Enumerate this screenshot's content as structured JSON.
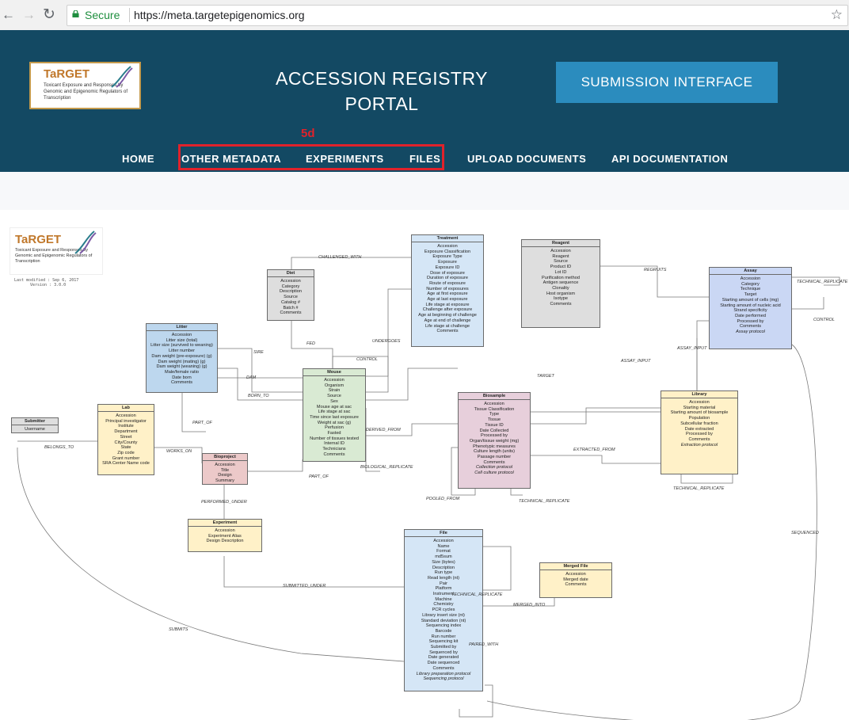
{
  "browser": {
    "back_icon": "←",
    "forward_icon": "→",
    "reload_icon": "↻",
    "secure_label": "Secure",
    "url": "https://meta.targetepigenomics.org",
    "star_icon": "☆"
  },
  "header": {
    "logo_title": "TaRGET",
    "logo_subtitle": "Toxicant Exposure and Responses by Genomic and Epigenomic Regulators of Transcription",
    "title_line1": "ACCESSION REGISTRY",
    "title_line2": "PORTAL",
    "submission_button": "SUBMISSION INTERFACE",
    "annotation": "5d",
    "menu": [
      "HOME",
      "OTHER METADATA",
      "EXPERIMENTS",
      "FILES",
      "UPLOAD DOCUMENTS",
      "API DOCUMENTATION"
    ]
  },
  "diagram": {
    "logo_title": "TaRGET",
    "logo_subtitle": "Toxicant Exposure and Responses by Genomic and Epigenomic Regulators of Transcription",
    "last_modified": "Last modified : Sep 6, 2017",
    "version": "Version : 3.0.0",
    "entities": {
      "treatment": {
        "title": "Treatment",
        "fields": [
          "Accession",
          "Exposure Classification",
          "Exposure Type",
          "Exposure",
          "Exposure ID",
          "Dose of exposure",
          "Duration of exposure",
          "Route of exposure",
          "Number of exposures",
          "Age at first exposure",
          "Age at last exposure",
          "Life stage at exposure",
          "Challenge after exposure",
          "Age at beginning of challenge",
          "Age at end of challenge",
          "Life stage at challenge",
          "Comments"
        ]
      },
      "reagent": {
        "title": "Reagent",
        "fields": [
          "Accession",
          "Reagent",
          "Source",
          "Product ID",
          "Lot ID",
          "Purification method",
          "Antigen sequence",
          "Clonality",
          "Host organism",
          "Isotype",
          "Comments"
        ]
      },
      "diet": {
        "title": "Diet",
        "fields": [
          "Accession",
          "Category",
          "Description",
          "Source",
          "Catalog #",
          "Batch #",
          "Comments"
        ]
      },
      "assay": {
        "title": "Assay",
        "fields": [
          "Accession",
          "Category",
          "Technique",
          "Target",
          "Starting amount of cells (mg)",
          "Starting amount of nucleic acid",
          "Strand specificity",
          "Date performed",
          "Processed by",
          "Comments",
          "Assay protocol"
        ]
      },
      "litter": {
        "title": "Litter",
        "fields": [
          "Accession",
          "Litter size (total)",
          "Litter size (survived to weaning)",
          "Litter number",
          "Dam weight (pre-exposure) (g)",
          "Dam weight (mating) (g)",
          "Dam weight (weaning) (g)",
          "Male/female ratio",
          "Date born",
          "Comments"
        ]
      },
      "mouse": {
        "title": "Mouse",
        "fields": [
          "Accession",
          "Organism",
          "Strain",
          "Source",
          "Sex",
          "Mouse age at sac",
          "Life stage at sac",
          "Time since last exposure",
          "Weight at sac (g)",
          "Perfusion",
          "Fasted",
          "Number of tissues tested",
          "Internal ID",
          "Technicians",
          "Comments"
        ]
      },
      "biosample": {
        "title": "Biosample",
        "fields": [
          "Accession",
          "Tissue Classification",
          "Type",
          "Tissue",
          "Tissue ID",
          "Date Collected",
          "Processed by",
          "Organ/tissue weight (mg)",
          "Phenotypic measures",
          "Culture length (units)",
          "Passage number",
          "Comments",
          "Collection protocol",
          "Cell culture protocol"
        ]
      },
      "library": {
        "title": "Library",
        "fields": [
          "Accession",
          "Starting material",
          "Starting amount of biosample",
          "Population",
          "Subcellular fraction",
          "Date extracted",
          "Processed by",
          "Comments",
          "Extraction protocol"
        ]
      },
      "lab": {
        "title": "Lab",
        "fields": [
          "Accession",
          "Principal investigator",
          "Institute",
          "Department",
          "Street",
          "City/County",
          "State",
          "Zip code",
          "Grant number",
          "SRA Center Name code"
        ]
      },
      "submitter": {
        "title": "Submitter",
        "fields": [
          "Username"
        ]
      },
      "bioproject": {
        "title": "Bioproject",
        "fields": [
          "Accession",
          "Title",
          "Design",
          "Summary"
        ]
      },
      "experiment": {
        "title": "Experiment",
        "fields": [
          "Accession",
          "Experiment Alias",
          "Design Description"
        ]
      },
      "file": {
        "title": "File",
        "fields": [
          "Accession",
          "Name",
          "Format",
          "md5sum",
          "Size (bytes)",
          "Description",
          "Run type",
          "Read length (nt)",
          "Pair",
          "Platform",
          "Instrument",
          "Machine",
          "Chemistry",
          "PCR cycles",
          "Library insert size (nt)",
          "Standard deviation (nt)",
          "Sequencing index",
          "Barcode",
          "Run number",
          "Sequencing kit",
          "Submitted by",
          "Sequenced by",
          "Date generated",
          "Date sequenced",
          "Comments",
          "Library preparation protocol",
          "Sequencing protocol"
        ]
      },
      "merged_file": {
        "title": "Merged File",
        "fields": [
          "Accession",
          "Merged date",
          "Comments"
        ]
      }
    },
    "relations": {
      "challenged_with": "CHALLENGED_WITH",
      "fed": "FED",
      "undergoes": "UNDERGOES",
      "sire": "SIRE",
      "dam": "DAM",
      "born_to": "BORN_TO",
      "control": "CONTROL",
      "target": "TARGET",
      "regruits": "REGRUITS",
      "technical_replicate_assay": "TECHNICAL_REPLICATE",
      "control_assay": "CONTROL",
      "assay_input": "ASSAY_INPUT",
      "assay_input2": "ASSAY_INPUT",
      "part_of": "PART_OF",
      "derived_from": "DERIVED_FROM",
      "belongs_to": "BELONGS_TO",
      "works_on": "WORKS_ON",
      "part_of2": "PART_OF",
      "biological_replicate": "BIOLOGICAL_REPLICATE",
      "extracted_from": "EXTRACTED_FROM",
      "technical_replicate_lib": "TECHNICAL_REPLICATE",
      "pooled_from": "POOLED_FROM",
      "technical_replicate_bio": "TECHNICAL_REPLICATE",
      "performed_under": "PERFORMED_UNDER",
      "sequenced": "SEQUENCED",
      "submitted_under": "SUBMITTED_UNDER",
      "technical_replicate_file": "TECHNICAL_REPLICATE",
      "merged_into": "MERGED_INTO",
      "submits": "SUBMITS",
      "paired_with": "PAIRED_WITH"
    }
  }
}
